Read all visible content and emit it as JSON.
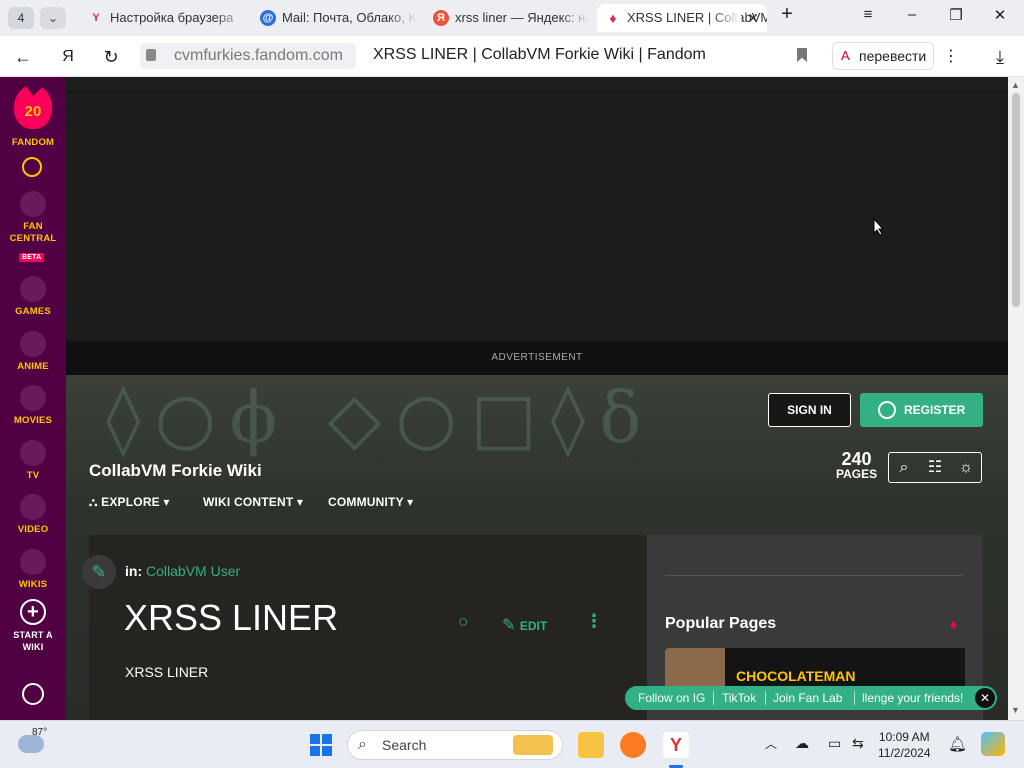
{
  "browser": {
    "tab_count": "4",
    "tabs": [
      {
        "title": "Настройка браузера",
        "favicon": "Y"
      },
      {
        "title": "Mail: Почта, Облако, Ка",
        "favicon": "@"
      },
      {
        "title": "xrss liner — Яндекс: на",
        "favicon": "Я"
      },
      {
        "title": "XRSS LINER | CollabVM",
        "favicon": "♦"
      }
    ],
    "url": "cvmfurkies.fandom.com",
    "page_title": "XRSS LINER | CollabVM Forkie Wiki | Fandom",
    "translate_label": "перевести"
  },
  "sidebar": {
    "badge": "20",
    "brand": "FANDOM",
    "items": [
      {
        "label": "FAN CENTRAL",
        "extra": "BETA"
      },
      {
        "label": "GAMES"
      },
      {
        "label": "ANIME"
      },
      {
        "label": "MOVIES"
      },
      {
        "label": "TV"
      },
      {
        "label": "VIDEO"
      },
      {
        "label": "WIKIS"
      },
      {
        "label": "START A WIKI"
      }
    ]
  },
  "ad": {
    "label": "ADVERTISEMENT"
  },
  "header": {
    "sign_in": "SIGN IN",
    "register": "REGISTER",
    "wiki_name": "CollabVM Forkie Wiki",
    "page_count": "240",
    "pages_label": "PAGES",
    "nav": [
      "EXPLORE",
      "WIKI CONTENT",
      "COMMUNITY"
    ]
  },
  "article": {
    "in_label": "in:",
    "category": "CollabVM User",
    "title": "XRSS LINER",
    "body": "XRSS LINER",
    "edit_label": "EDIT"
  },
  "rail": {
    "popular_title": "Popular Pages",
    "popular_items": [
      "CHOCOLATEMAN"
    ]
  },
  "fanlab": {
    "items": [
      "Follow on IG",
      "TikTok",
      "Join Fan Lab",
      "llenge your friends!"
    ]
  },
  "taskbar": {
    "weather": "87°",
    "search_placeholder": "Search",
    "time": "10:09 AM",
    "date": "11/2/2024"
  }
}
